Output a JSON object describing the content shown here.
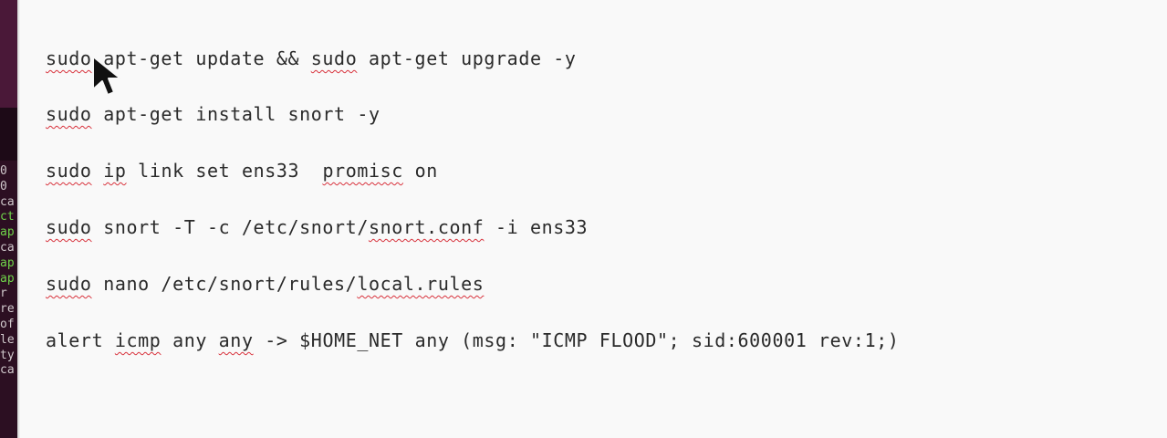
{
  "terminal": {
    "lines": [
      {
        "text": "0",
        "color": "#d0c8cc"
      },
      {
        "text": "0",
        "color": "#d0c8cc"
      },
      {
        "text": "ca",
        "color": "#d0c8cc"
      },
      {
        "text": "ct",
        "color": "#6fd24a"
      },
      {
        "text": "ap",
        "color": "#6fd24a"
      },
      {
        "text": "ca",
        "color": "#d0c8cc"
      },
      {
        "text": "ap",
        "color": "#6fd24a"
      },
      {
        "text": "ap",
        "color": "#6fd24a"
      },
      {
        "text": "r",
        "color": "#d0c8cc"
      },
      {
        "text": "re",
        "color": "#d0c8cc"
      },
      {
        "text": "of",
        "color": "#d0c8cc"
      },
      {
        "text": "le",
        "color": "#d0c8cc"
      },
      {
        "text": "ty",
        "color": "#d0c8cc"
      },
      {
        "text": "ca",
        "color": "#d0c8cc"
      }
    ]
  },
  "document": {
    "lines": [
      {
        "segments": [
          {
            "text": "sudo",
            "squiggle": true
          },
          {
            "text": " apt-get update && ",
            "squiggle": false
          },
          {
            "text": "sudo",
            "squiggle": true
          },
          {
            "text": " apt-get upgrade -y",
            "squiggle": false
          }
        ]
      },
      {
        "segments": [
          {
            "text": "sudo",
            "squiggle": true
          },
          {
            "text": " apt-get install snort -y",
            "squiggle": false
          }
        ]
      },
      {
        "segments": [
          {
            "text": "sudo",
            "squiggle": true
          },
          {
            "text": " ",
            "squiggle": false
          },
          {
            "text": "ip",
            "squiggle": true
          },
          {
            "text": " link set ens33  ",
            "squiggle": false
          },
          {
            "text": "promisc",
            "squiggle": true
          },
          {
            "text": " on",
            "squiggle": false
          }
        ]
      },
      {
        "segments": [
          {
            "text": "sudo",
            "squiggle": true
          },
          {
            "text": " snort -T -c /etc/snort/",
            "squiggle": false
          },
          {
            "text": "snort.conf",
            "squiggle": true
          },
          {
            "text": " -i ens33",
            "squiggle": false
          }
        ]
      },
      {
        "segments": [
          {
            "text": "sudo",
            "squiggle": true
          },
          {
            "text": " nano /etc/snort/rules/",
            "squiggle": false
          },
          {
            "text": "local.rules",
            "squiggle": true
          }
        ]
      },
      {
        "segments": [
          {
            "text": "alert ",
            "squiggle": false
          },
          {
            "text": "icmp",
            "squiggle": true
          },
          {
            "text": " any ",
            "squiggle": false
          },
          {
            "text": "any",
            "squiggle": true
          },
          {
            "text": " -> $HOME_NET any (msg: \"ICMP FLOOD\"; sid:600001 rev:1;)",
            "squiggle": false
          }
        ]
      }
    ]
  },
  "cursor": {
    "icon": "mouse-pointer-icon"
  }
}
